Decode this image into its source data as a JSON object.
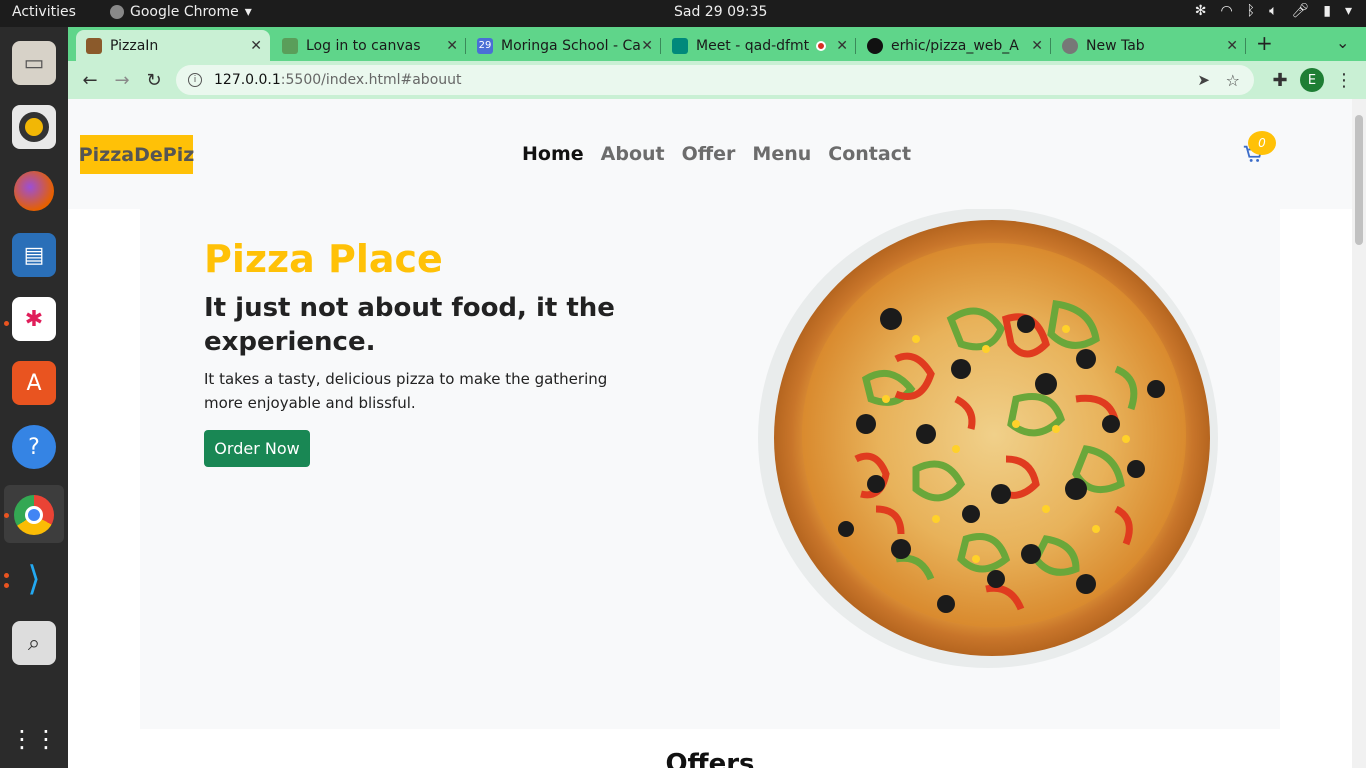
{
  "system": {
    "activities": "Activities",
    "app_menu": "Google Chrome",
    "clock": "Sad 29  09:35"
  },
  "dock": [
    "files",
    "rhythmbox",
    "firefox",
    "writer",
    "slack",
    "software",
    "help",
    "chrome",
    "vscode",
    "search",
    "show-apps"
  ],
  "browser": {
    "tabs": [
      {
        "title": "PizzaIn",
        "active": true
      },
      {
        "title": "Log in to canvas",
        "active": false
      },
      {
        "title": "Moringa School - Ca",
        "active": false
      },
      {
        "title": "Meet - qad-dfmt",
        "active": false
      },
      {
        "title": "erhic/pizza_web_A",
        "active": false
      },
      {
        "title": "New Tab",
        "active": false
      }
    ],
    "url_host": "127.0.0.1",
    "url_path": ":5500/index.html#abouut",
    "profile_initial": "E"
  },
  "page": {
    "brand": "PizzaDePiz",
    "nav": [
      "Home",
      "About",
      "Offer",
      "Menu",
      "Contact"
    ],
    "cart_count": "0",
    "hero": {
      "title": "Pizza Place",
      "subtitle": "It just not about food, it the experience.",
      "description": "It takes a tasty, delicious pizza to make the gathering more enjoyable and blissful.",
      "cta": "Order Now"
    },
    "offers_title": "Offers"
  },
  "colors": {
    "accent_yellow": "#ffc107",
    "cta_green": "#198754",
    "tabstrip_green": "#5fd58a"
  }
}
